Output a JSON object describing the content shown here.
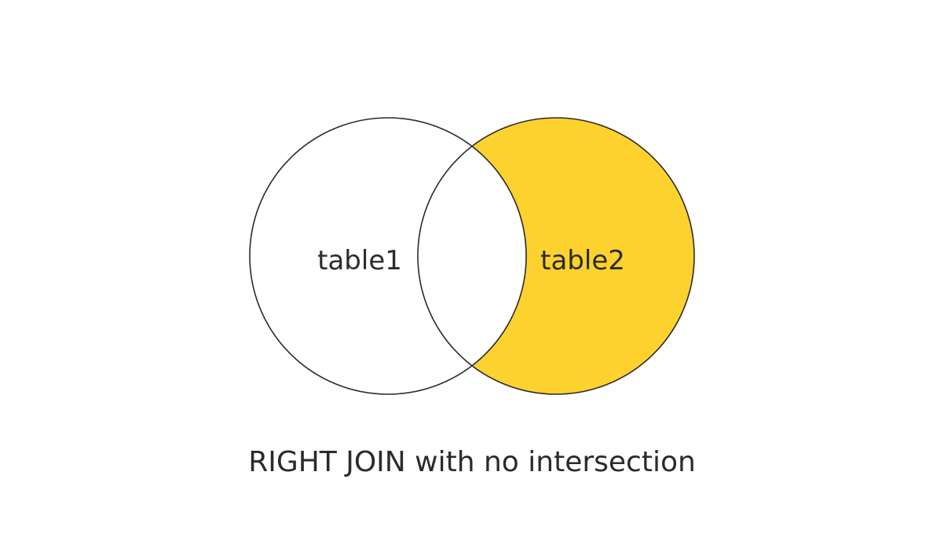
{
  "diagram": {
    "left_set_label": "table1",
    "right_set_label": "table2",
    "caption": "RIGHT JOIN with no intersection",
    "colors": {
      "highlight_fill": "#FDD22F",
      "stroke": "#2b2b2b",
      "background": "#ffffff",
      "text": "#2b2b2b"
    }
  }
}
